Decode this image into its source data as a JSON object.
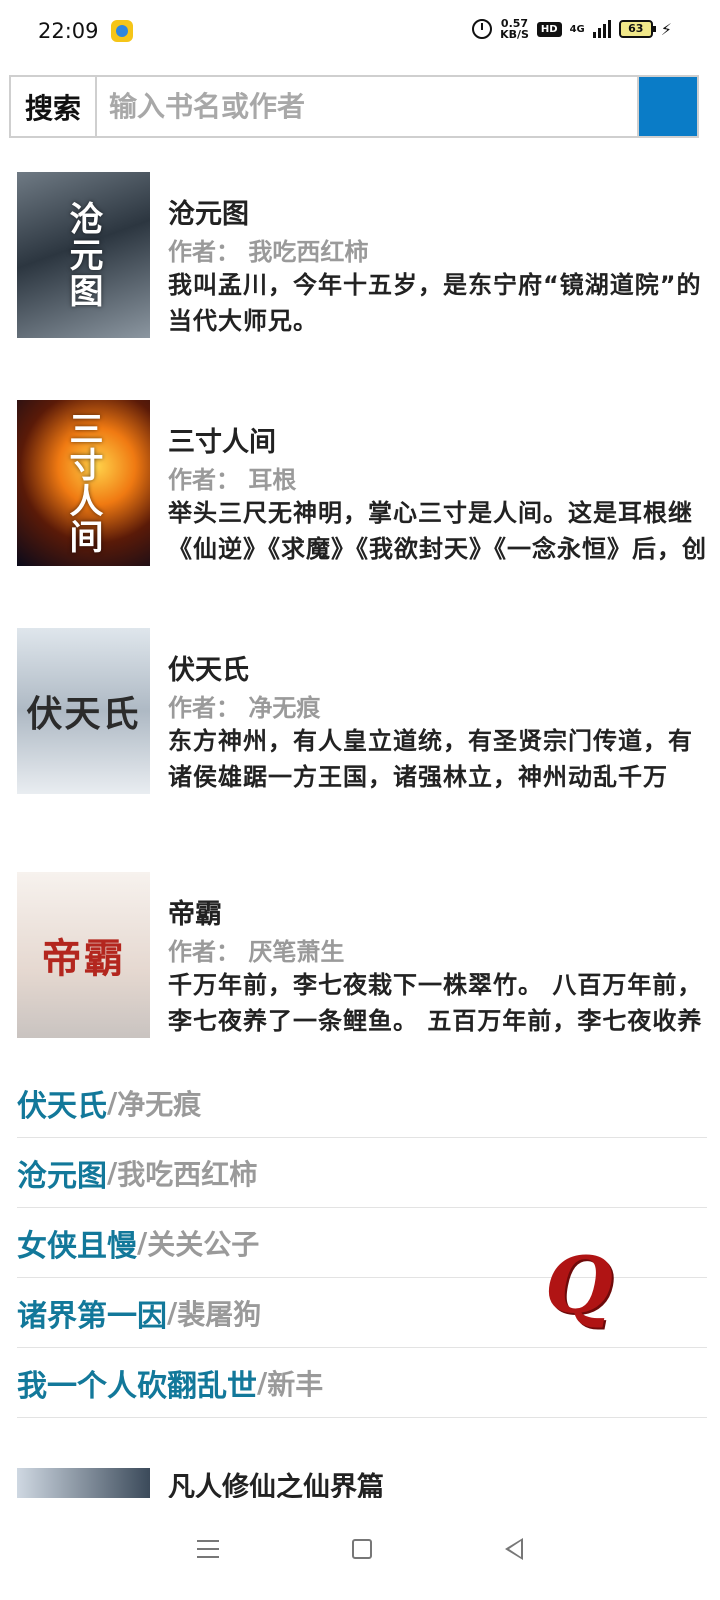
{
  "status_bar": {
    "time": "22:09",
    "net_speed_value": "0.57",
    "net_speed_unit": "KB/S",
    "hd_badge": "HD",
    "network": "4G",
    "battery": "63",
    "icons": [
      "app-notification-icon",
      "alarm-icon",
      "signal-icon",
      "battery-icon",
      "charging-icon"
    ]
  },
  "search": {
    "label": "搜索",
    "placeholder": "输入书名或作者",
    "button_color": "#0a7cc7"
  },
  "books": [
    {
      "cover_text": "沧元图",
      "title": "沧元图",
      "author_label": "作者：",
      "author": "我吃西红柿",
      "description": "我叫孟川，今年十五岁，是东宁府“镜湖道院”的当代大师兄。"
    },
    {
      "cover_text": "三寸人间",
      "title": "三寸人间",
      "author_label": "作者：",
      "author": "耳根",
      "description": "举头三尺无神明，掌心三寸是人间。这是耳根继《仙逆》《求魔》《我欲封天》《一念永恒》后，创作的第五部长篇小说《三寸人间》。"
    },
    {
      "cover_text": "伏天氏",
      "title": "伏天氏",
      "author_label": "作者：",
      "author": "净无痕",
      "description": "东方神州，有人皇立道统，有圣贤宗门传道，有诸侯雄踞一方王国，诸强林立，神州动乱千万载，就此之时，一代天骄叶青帝及东凰大帝。"
    },
    {
      "cover_text": "帝霸",
      "title": "帝霸",
      "author_label": "作者：",
      "author": "厌笔萧生",
      "description": "千万年前，李七夜栽下一株翠竹。 八百万年前，李七夜养了一条鲤鱼。 五百万年前，李七夜收养一个小女孩。"
    }
  ],
  "recommended": [
    {
      "title": "伏天氏",
      "sep": "/",
      "author": "净无痕"
    },
    {
      "title": "沧元图",
      "sep": "/",
      "author": "我吃西红柿"
    },
    {
      "title": "女侠且慢",
      "sep": "/",
      "author": "关关公子"
    },
    {
      "title": "诸界第一因",
      "sep": "/",
      "author": "裴屠狗"
    },
    {
      "title": "我一个人砍翻乱世",
      "sep": "/",
      "author": "新丰"
    }
  ],
  "logo_letter": "Q",
  "partial_book": {
    "title": "凡人修仙之仙界篇"
  },
  "colors": {
    "accent": "#0a7cc7",
    "rec_title": "#12789a",
    "muted": "#9a9a9a",
    "logo": "#b01414"
  }
}
